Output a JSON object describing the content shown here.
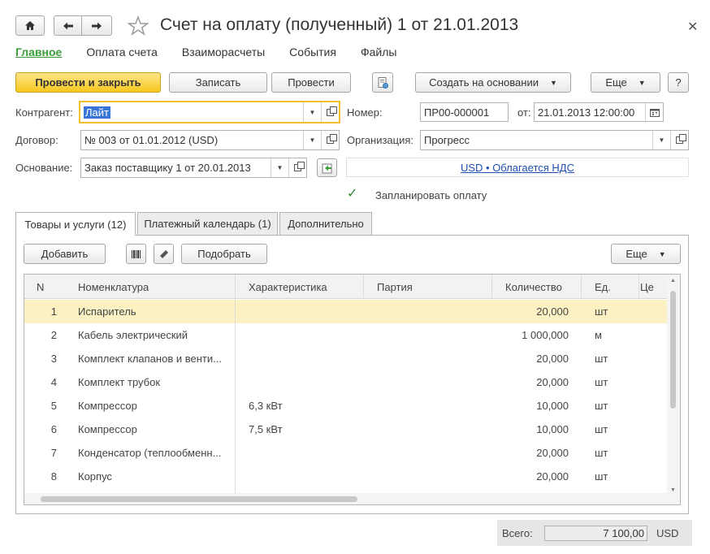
{
  "header": {
    "title": "Счет на оплату (полученный) 1 от 21.01.2013"
  },
  "section_nav": [
    "Главное",
    "Оплата счета",
    "Взаиморасчеты",
    "События",
    "Файлы"
  ],
  "toolbar": {
    "post_close": "Провести и закрыть",
    "write": "Записать",
    "post": "Провести",
    "create_based": "Создать на основании",
    "more": "Еще",
    "help": "?"
  },
  "form": {
    "counterparty_label": "Контрагент:",
    "counterparty_value": "Лайт",
    "contract_label": "Договор:",
    "contract_value": "№ 003 от 01.01.2012 (USD)",
    "basis_label": "Основание:",
    "basis_value": "Заказ поставщику 1 от 20.01.2013",
    "number_label": "Номер:",
    "number_value": "ПР00-000001",
    "date_label": "от:",
    "date_value": "21.01.2013 12:00:00",
    "org_label": "Организация:",
    "org_value": "Прогресс",
    "vat_link": "USD • Облагается НДС",
    "plan_payment_label": "Запланировать оплату",
    "plan_payment_checked": true
  },
  "tabs": [
    "Товары и услуги (12)",
    "Платежный календарь (1)",
    "Дополнительно"
  ],
  "table_toolbar": {
    "add": "Добавить",
    "pick": "Подобрать",
    "more": "Еще"
  },
  "table": {
    "columns": [
      "N",
      "Номенклатура",
      "Характеристика",
      "Партия",
      "Количество",
      "Ед.",
      "Це"
    ],
    "rows": [
      {
        "n": "1",
        "item": "Испаритель",
        "char": "",
        "batch": "",
        "qty": "20,000",
        "unit": "шт"
      },
      {
        "n": "2",
        "item": "Кабель электрический",
        "char": "",
        "batch": "",
        "qty": "1 000,000",
        "unit": "м"
      },
      {
        "n": "3",
        "item": "Комплект клапанов и венти...",
        "char": "",
        "batch": "",
        "qty": "20,000",
        "unit": "шт"
      },
      {
        "n": "4",
        "item": "Комплект трубок",
        "char": "",
        "batch": "",
        "qty": "20,000",
        "unit": "шт"
      },
      {
        "n": "5",
        "item": "Компрессор",
        "char": "6,3 кВт",
        "batch": "",
        "qty": "10,000",
        "unit": "шт"
      },
      {
        "n": "6",
        "item": "Компрессор",
        "char": "7,5 кВт",
        "batch": "",
        "qty": "10,000",
        "unit": "шт"
      },
      {
        "n": "7",
        "item": "Конденсатор (теплообменн...",
        "char": "",
        "batch": "",
        "qty": "20,000",
        "unit": "шт"
      },
      {
        "n": "8",
        "item": "Корпус",
        "char": "",
        "batch": "",
        "qty": "20,000",
        "unit": "шт"
      }
    ]
  },
  "footer": {
    "total_label": "Всего:",
    "total_value": "7 100,00",
    "currency": "USD"
  },
  "colors": {
    "accent_green": "#3a9e3a",
    "primary_button": "#f6c81e",
    "selected_row": "#fbf1c3",
    "link": "#1f4fb0"
  }
}
